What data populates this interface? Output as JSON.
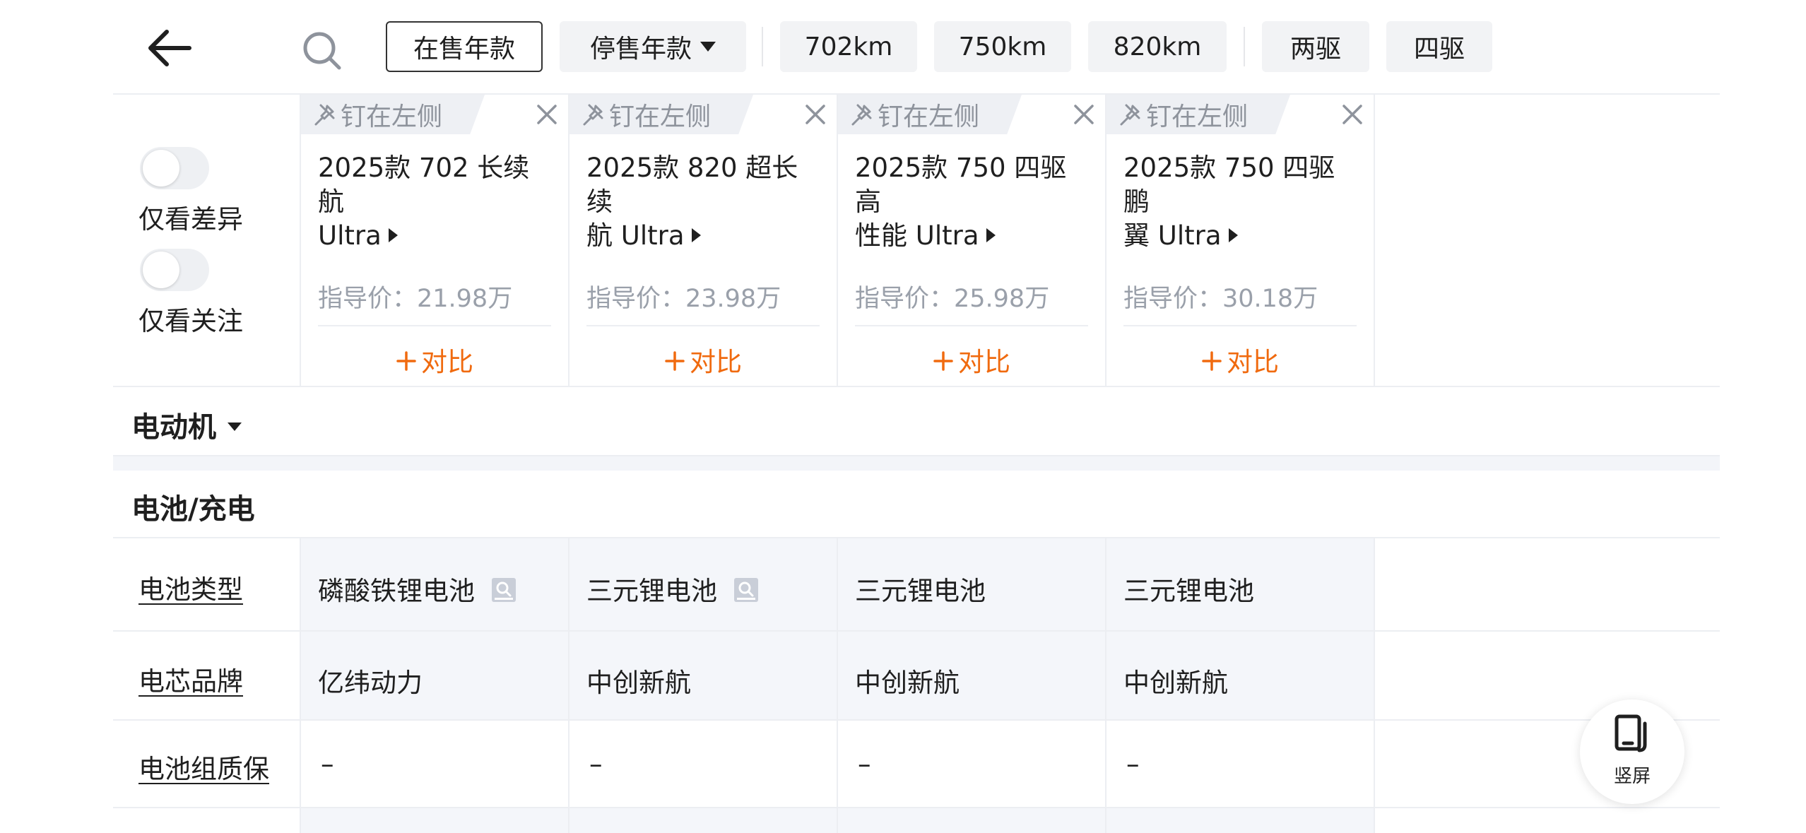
{
  "toolbar": {
    "filters": [
      {
        "label": "在售年款",
        "active": true
      },
      {
        "label": "停售年款",
        "has_dropdown": true
      },
      {
        "label": "702km"
      },
      {
        "label": "750km"
      },
      {
        "label": "820km"
      },
      {
        "label": "两驱"
      },
      {
        "label": "四驱"
      }
    ]
  },
  "toggles": [
    {
      "label": "仅看差异",
      "on": false
    },
    {
      "label": "仅看关注",
      "on": false
    }
  ],
  "pin_label": "钉在左侧",
  "compare_label": "对比",
  "cars": [
    {
      "name_line1": "2025款 702 长续航",
      "name_line2": "Ultra",
      "price": "指导价：21.98万"
    },
    {
      "name_line1": "2025款 820 超长续",
      "name_line2": "航 Ultra",
      "price": "指导价：23.98万"
    },
    {
      "name_line1": "2025款 750 四驱高",
      "name_line2": "性能 Ultra",
      "price": "指导价：25.98万"
    },
    {
      "name_line1": "2025款 750 四驱鹏",
      "name_line2": "翼 Ultra",
      "price": "指导价：30.18万"
    }
  ],
  "sections": {
    "motor": {
      "title": "电动机"
    },
    "battery": {
      "title": "电池/充电",
      "rows": [
        {
          "label": "电池类型",
          "values": [
            "磷酸铁锂电池",
            "三元锂电池",
            "三元锂电池",
            "三元锂电池"
          ]
        },
        {
          "label": "电芯品牌",
          "values": [
            "亿纬动力",
            "中创新航",
            "中创新航",
            "中创新航"
          ]
        },
        {
          "label": "电池组质保",
          "values": [
            "–",
            "–",
            "–",
            "–"
          ]
        }
      ]
    }
  },
  "fab": {
    "label": "竖屏",
    "icon": "rotate-portrait-icon"
  },
  "colors": {
    "accent": "#f06a0f",
    "muted": "#9aa0aa",
    "shade": "#f4f6fa"
  }
}
